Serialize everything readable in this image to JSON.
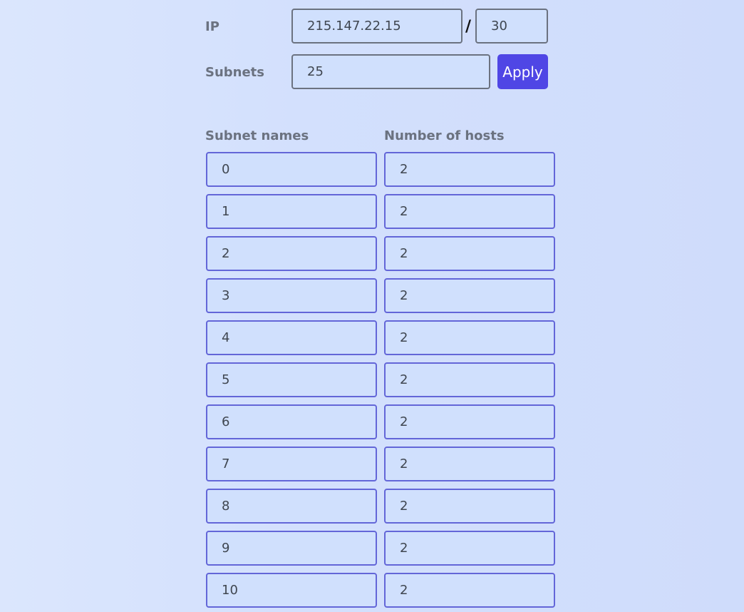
{
  "ip_row": {
    "label": "IP",
    "ip_value": "215.147.22.15",
    "separator": "/",
    "prefix_value": "30"
  },
  "subnets_row": {
    "label": "Subnets",
    "count_value": "25",
    "apply_label": "Apply"
  },
  "table": {
    "headers": {
      "names": "Subnet names",
      "hosts": "Number of hosts"
    },
    "rows": [
      {
        "name": "0",
        "hosts": "2"
      },
      {
        "name": "1",
        "hosts": "2"
      },
      {
        "name": "2",
        "hosts": "2"
      },
      {
        "name": "3",
        "hosts": "2"
      },
      {
        "name": "4",
        "hosts": "2"
      },
      {
        "name": "5",
        "hosts": "2"
      },
      {
        "name": "6",
        "hosts": "2"
      },
      {
        "name": "7",
        "hosts": "2"
      },
      {
        "name": "8",
        "hosts": "2"
      },
      {
        "name": "9",
        "hosts": "2"
      },
      {
        "name": "10",
        "hosts": "2"
      }
    ]
  },
  "colors": {
    "accent": "#4f46e5",
    "field_border": "#6366d8",
    "label": "#6b7280"
  }
}
